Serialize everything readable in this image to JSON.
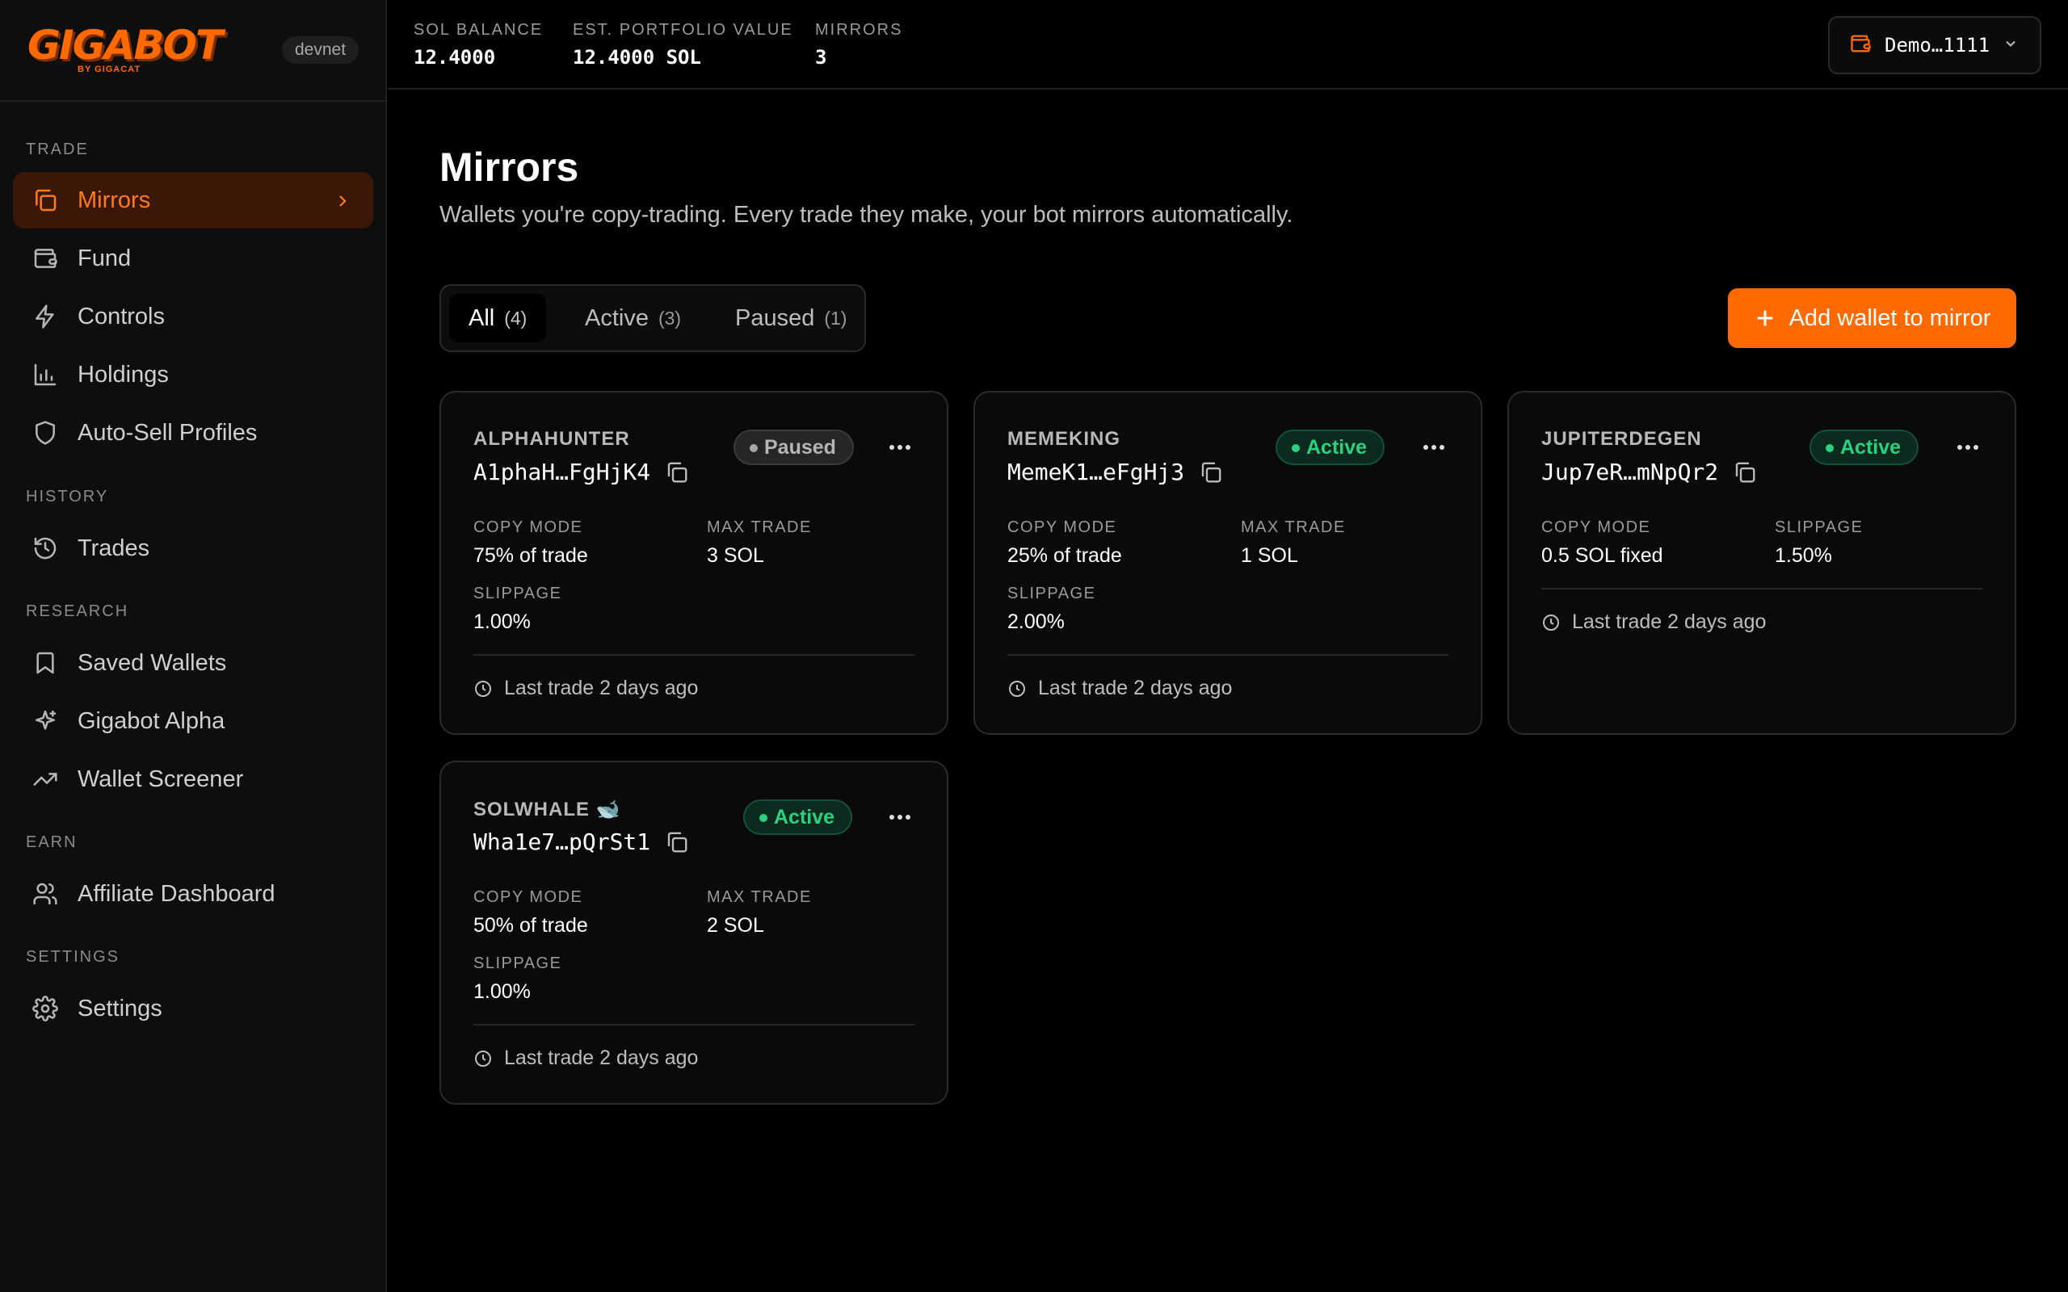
{
  "brand": {
    "logo_text": "GIGABOT",
    "logo_sub": "BY GIGACAT",
    "network": "devnet"
  },
  "sidebar": {
    "sections": [
      "TRADE",
      "HISTORY",
      "RESEARCH",
      "EARN",
      "SETTINGS"
    ],
    "items": [
      {
        "label": "Mirrors",
        "icon": "copy-icon",
        "active": true
      },
      {
        "label": "Fund",
        "icon": "wallet-icon"
      },
      {
        "label": "Controls",
        "icon": "lightning-icon"
      },
      {
        "label": "Holdings",
        "icon": "bar-chart-icon"
      },
      {
        "label": "Auto-Sell Profiles",
        "icon": "shield-icon"
      },
      {
        "label": "Trades",
        "icon": "history-icon"
      },
      {
        "label": "Saved Wallets",
        "icon": "bookmark-icon"
      },
      {
        "label": "Gigabot Alpha",
        "icon": "sparkles-icon"
      },
      {
        "label": "Wallet Screener",
        "icon": "trending-up-icon"
      },
      {
        "label": "Affiliate Dashboard",
        "icon": "users-icon"
      },
      {
        "label": "Settings",
        "icon": "gear-icon"
      }
    ]
  },
  "topbar": {
    "stats": [
      {
        "label": "SOL BALANCE",
        "value": "12.4000"
      },
      {
        "label": "EST. PORTFOLIO VALUE",
        "value": "12.4000 SOL"
      },
      {
        "label": "MIRRORS",
        "value": "3"
      }
    ],
    "wallet": "Demo…1111"
  },
  "main": {
    "title": "Mirrors",
    "subtitle": "Wallets you're copy-trading. Every trade they make, your bot mirrors automatically.",
    "tabs": [
      {
        "label": "All",
        "count": "(4)",
        "active": true
      },
      {
        "label": "Active",
        "count": "(3)"
      },
      {
        "label": "Paused",
        "count": "(1)"
      }
    ],
    "add_button": "Add wallet to mirror"
  },
  "cards": [
    {
      "name": "ALPHAHUNTER",
      "address": "A1phaH…FgHjK4",
      "status": "Paused",
      "copy_mode_label": "COPY MODE",
      "copy_mode": "75% of trade",
      "max_trade_label": "MAX TRADE",
      "max_trade": "3 SOL",
      "slippage_label": "SLIPPAGE",
      "slippage": "1.00%",
      "last_trade": "Last trade 2 days ago"
    },
    {
      "name": "MEMEKING",
      "address": "MemeK1…eFgHj3",
      "status": "Active",
      "copy_mode_label": "COPY MODE",
      "copy_mode": "25% of trade",
      "max_trade_label": "MAX TRADE",
      "max_trade": "1 SOL",
      "slippage_label": "SLIPPAGE",
      "slippage": "2.00%",
      "last_trade": "Last trade 2 days ago"
    },
    {
      "name": "JUPITERDEGEN",
      "address": "Jup7eR…mNpQr2",
      "status": "Active",
      "copy_mode_label": "COPY MODE",
      "copy_mode": "0.5 SOL fixed",
      "slippage_label": "SLIPPAGE",
      "slippage": "1.50%",
      "last_trade": "Last trade 2 days ago"
    },
    {
      "name": "SOLWHALE 🐋",
      "address": "Wha1e7…pQrSt1",
      "status": "Active",
      "copy_mode_label": "COPY MODE",
      "copy_mode": "50% of trade",
      "max_trade_label": "MAX TRADE",
      "max_trade": "2 SOL",
      "slippage_label": "SLIPPAGE",
      "slippage": "1.00%",
      "last_trade": "Last trade 2 days ago"
    }
  ],
  "colors": {
    "accent": "#ff6a00",
    "active_green": "#2bd17f",
    "background": "#000000",
    "sidebar": "#0e0e0e"
  }
}
